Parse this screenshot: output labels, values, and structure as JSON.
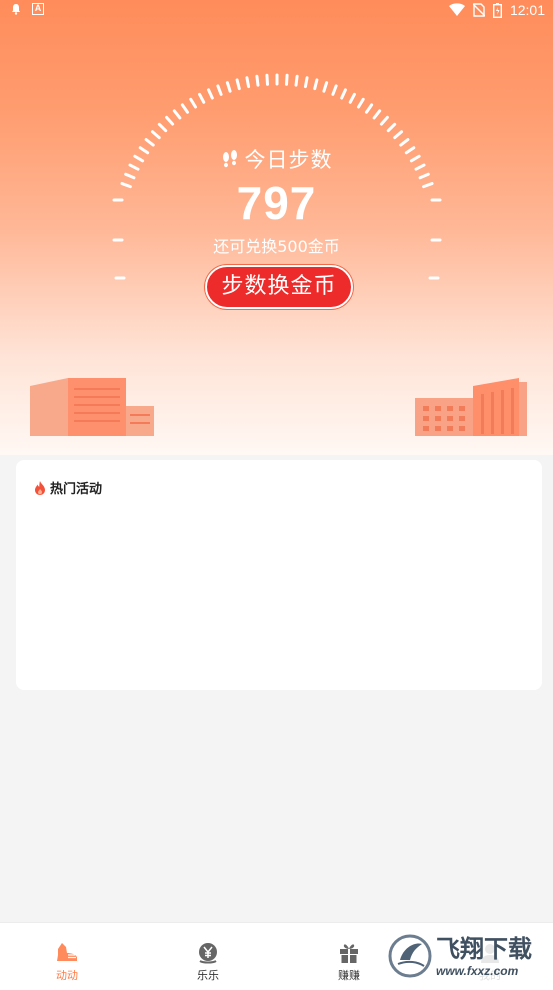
{
  "status_bar": {
    "time": "12:01",
    "left_icons": [
      "notification-bell-icon",
      "a-box-icon"
    ],
    "right_icons": [
      "wifi-icon",
      "no-sim-icon",
      "battery-icon"
    ]
  },
  "hero": {
    "title": "今日步数",
    "steps": "797",
    "subtitle": "还可兑换500金币",
    "convert_button": "步数换金币",
    "colors": {
      "gradient_top": "#ff8c5a",
      "gradient_bottom": "#fff8f4",
      "button": "#ee2b2b"
    }
  },
  "hot_activities": {
    "title": "热门活动"
  },
  "tabbar": {
    "tabs": [
      {
        "label": "动动",
        "icon": "sneaker-icon",
        "active": true
      },
      {
        "label": "乐乐",
        "icon": "yen-coin-icon",
        "active": false
      },
      {
        "label": "赚赚",
        "icon": "gift-icon",
        "active": false
      },
      {
        "label": "我的",
        "icon": "profile-icon",
        "active": false
      }
    ],
    "active_color": "#ff7a45"
  },
  "watermark": {
    "title": "飞翔下载",
    "url": "www.fxxz.com"
  }
}
